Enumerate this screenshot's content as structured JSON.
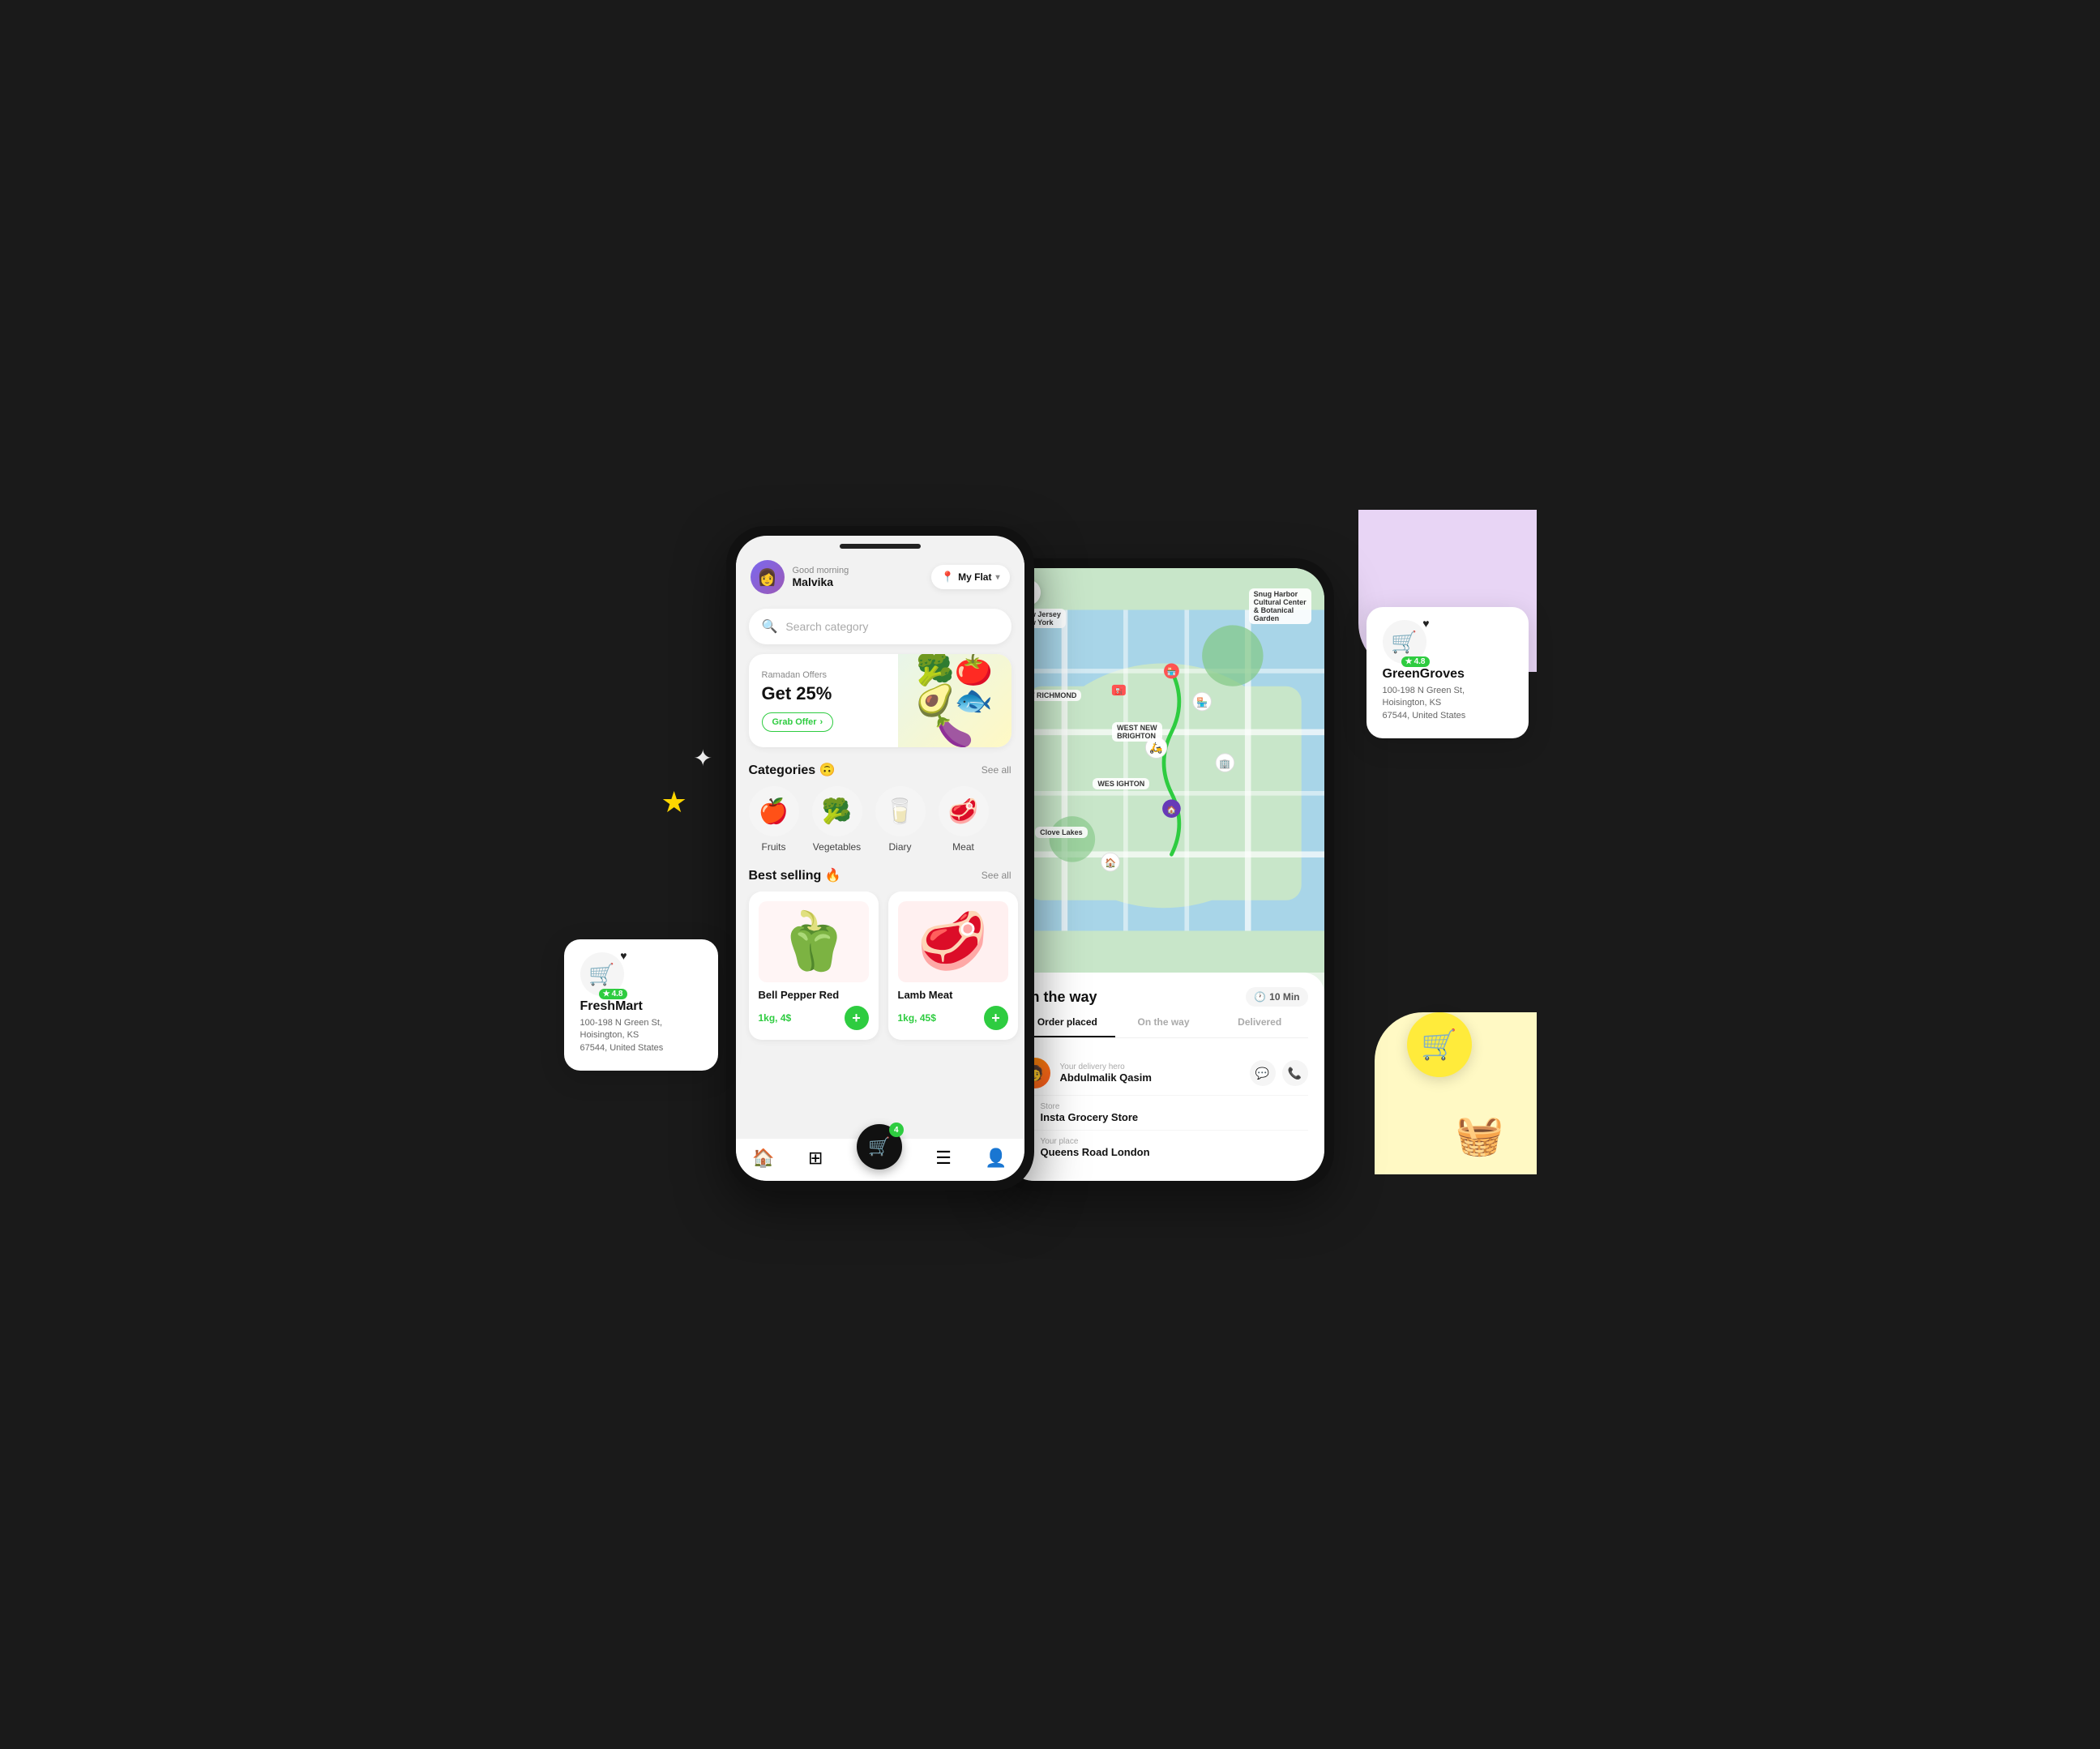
{
  "scene": {
    "stars": {
      "gold": "★",
      "white": "✦"
    }
  },
  "store_left": {
    "basket_emoji": "🛒",
    "heart": "♥",
    "rating": "4.8",
    "star": "★",
    "name": "FreshMart",
    "address": "100-198 N Green St,\nHoisington, KS\n67544, United States"
  },
  "store_right": {
    "basket_emoji": "🛒",
    "heart": "♥",
    "rating": "4.8",
    "star": "★",
    "name": "GreenGroves",
    "address": "100-198 N Green St,\nHoisington, KS\n67544, United States"
  },
  "phone_main": {
    "greeting": "Good morning",
    "user_name": "Malvika",
    "avatar_emoji": "👩",
    "location": {
      "label": "My Flat",
      "icon": "📍",
      "chevron": "▾"
    },
    "search": {
      "placeholder": "Search category",
      "icon": "🔍"
    },
    "offer_banner": {
      "label": "Ramadan Offers",
      "headline": "Get 25%",
      "button_label": "Grab Offer",
      "arrow": "›",
      "food_emoji": "🥦🍅🥑🐟🍆"
    },
    "categories": {
      "title": "Categories",
      "emoji": "🙃",
      "see_all": "See all",
      "items": [
        {
          "emoji": "🍎",
          "label": "Fruits"
        },
        {
          "emoji": "🥦",
          "label": "Vegetables"
        },
        {
          "emoji": "🥛",
          "label": "Diary"
        },
        {
          "emoji": "🥩",
          "label": "Meat"
        }
      ]
    },
    "best_selling": {
      "title": "Best selling",
      "emoji": "🔥",
      "see_all": "See all",
      "products": [
        {
          "emoji": "🫑",
          "name": "Bell Pepper Red",
          "price": "1kg, 4$"
        },
        {
          "emoji": "🥩",
          "name": "Lamb Meat",
          "price": "1kg, 45$"
        }
      ]
    },
    "bottom_nav": {
      "home_icon": "🏠",
      "grid_icon": "⊞",
      "cart_icon": "🛒",
      "cart_count": "4",
      "list_icon": "☰",
      "profile_icon": "👤"
    }
  },
  "phone_map": {
    "back_icon": "‹",
    "map_labels": [
      {
        "text": "New Jersey\nNew York",
        "top": "12%",
        "left": "5%"
      },
      {
        "text": "Snug Harbor\nCultural Center\n& Botanical\nGarden",
        "top": "5%",
        "right": "5%"
      },
      {
        "text": "PORT RICHMOND",
        "top": "28%",
        "left": "2%"
      },
      {
        "text": "WEST NEW\nBRIGHTON",
        "top": "35%",
        "left": "35%"
      },
      {
        "text": "WES IGHTON",
        "top": "52%",
        "left": "30%"
      },
      {
        "text": "Clove Lakes",
        "top": "62%",
        "left": "15%"
      }
    ],
    "ontheway": {
      "title": "On the way",
      "time_icon": "🕐",
      "time_label": "10 Min",
      "steps": [
        {
          "label": "Order placed",
          "active": true
        },
        {
          "label": "On the way",
          "active": false
        },
        {
          "label": "Delivered",
          "active": false
        }
      ],
      "delivery_hero": {
        "sub_label": "Your delivery hero",
        "name": "Abdulmalik Qasim",
        "emoji": "🧑",
        "actions": [
          "💬",
          "📞"
        ]
      },
      "store": {
        "sub_label": "Store",
        "name": "Insta Grocery Store",
        "dot_color": "red"
      },
      "your_place": {
        "sub_label": "Your place",
        "name": "Queens Road London",
        "dot_color": "black"
      }
    }
  },
  "floating": {
    "basket_emoji": "🛒",
    "red_basket_emoji": "🧺"
  }
}
